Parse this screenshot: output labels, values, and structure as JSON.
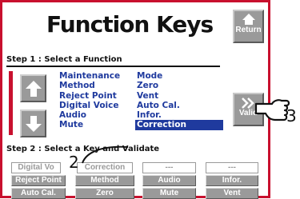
{
  "title": "Function Keys",
  "return_label": "Return",
  "valid_label": "Valid",
  "step1": "Step 1 : Select a Function",
  "step2": "Step 2 : Select a Key and Validate",
  "functions_col1": [
    "Maintenance",
    "Method",
    "Reject Point",
    "Digital Voice",
    "Audio",
    "Mute"
  ],
  "functions_col2": [
    "Mode",
    "Zero",
    "Vent",
    "Auto Cal.",
    "Infor.",
    "Correction"
  ],
  "selected_function": "Correction",
  "key_rows": [
    [
      "Digital Vo",
      "Correction",
      "---",
      "---",
      "---"
    ],
    [
      "Reject Point",
      "Method",
      "Audio",
      "Infor.",
      ""
    ],
    [
      "Auto Cal.",
      "Zero",
      "Mute",
      "Vent",
      ""
    ]
  ],
  "callouts": {
    "c2": "2",
    "c3": "3"
  },
  "colors": {
    "frame": "#c8102e",
    "text_blue": "#1f3a9e",
    "button_gray": "#9a9a9a"
  }
}
